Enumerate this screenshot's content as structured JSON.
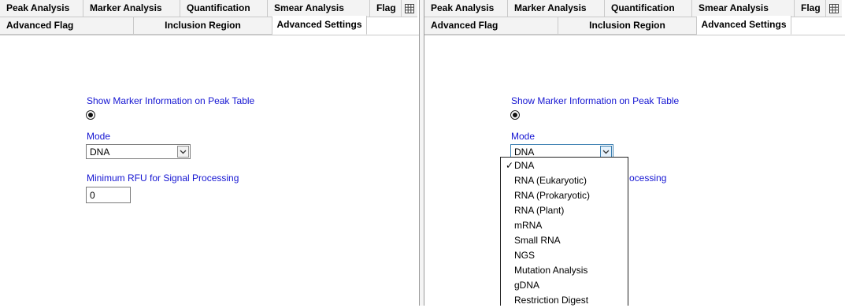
{
  "tabs_row1": [
    "Peak Analysis",
    "Marker Analysis",
    "Quantification",
    "Smear Analysis",
    "Flag"
  ],
  "tabs_row2": [
    "Advanced Flag",
    "Inclusion Region",
    "Advanced Settings"
  ],
  "tab_overflow_icon": "table-grid-icon",
  "settings": {
    "show_marker_label": "Show Marker Information on Peak Table",
    "mode_label": "Mode",
    "mode_value": "DNA",
    "min_rfu_label": "Minimum RFU for Signal Processing",
    "min_rfu_value": "0",
    "min_rfu_label_partial": "ocessing"
  },
  "mode_options": [
    "DNA",
    "RNA (Eukaryotic)",
    "RNA (Prokaryotic)",
    "RNA (Plant)",
    "mRNA",
    "Small RNA",
    "NGS",
    "Mutation Analysis",
    "gDNA",
    "Restriction Digest"
  ],
  "selected_option_check": "✓",
  "colors": {
    "label_blue": "#1414d2",
    "tab_bg": "#f3f3f3"
  }
}
